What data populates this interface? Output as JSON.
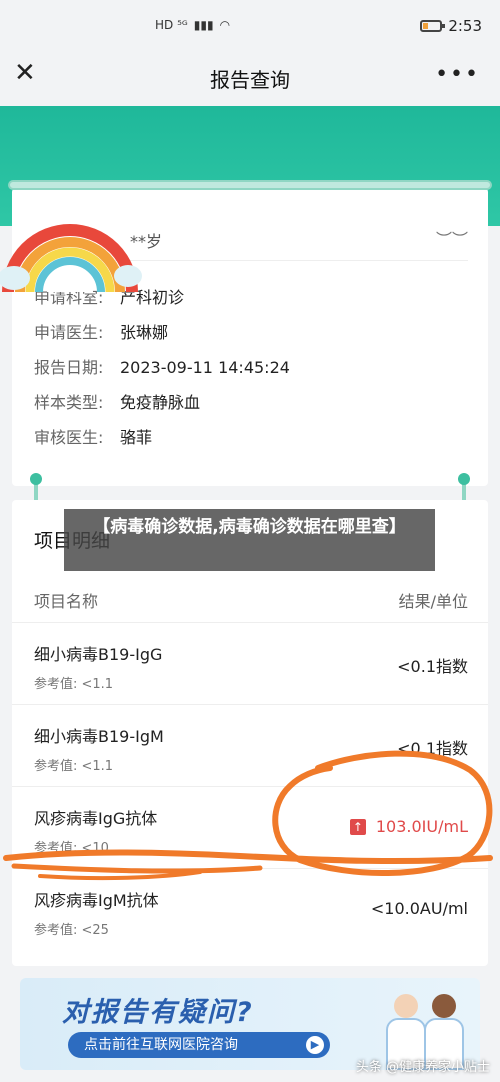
{
  "status_bar": {
    "network": "HD ⁵ᴳ",
    "time": "2:53"
  },
  "nav": {
    "title": "报告查询",
    "more": "•••",
    "close": "✕"
  },
  "patient": {
    "age_masked": "**岁",
    "rows": [
      {
        "label": "申请科室:",
        "value": "产科初诊"
      },
      {
        "label": "申请医生:",
        "value": "张琳娜"
      },
      {
        "label": "报告日期:",
        "value": "2023-09-11 14:45:24"
      },
      {
        "label": "样本类型:",
        "value": "免疫静脉血"
      },
      {
        "label": "审核医生:",
        "value": "骆菲"
      }
    ]
  },
  "details": {
    "title": "项目明细",
    "col_name": "项目名称",
    "col_result": "结果/单位",
    "items": [
      {
        "name": "细小病毒B19-IgG",
        "ref": "参考值: <1.1",
        "result": "<0.1指数",
        "high": false
      },
      {
        "name": "细小病毒B19-IgM",
        "ref": "参考值: <1.1",
        "result": "<0.1指数",
        "high": false
      },
      {
        "name": "风疹病毒IgG抗体",
        "ref": "参考值: <10",
        "result": "103.0IU/mL",
        "high": true
      },
      {
        "name": "风疹病毒IgM抗体",
        "ref": "参考值: <25",
        "result": "<10.0AU/ml",
        "high": false
      }
    ]
  },
  "overlay_title": "【病毒确诊数据,病毒确诊数据在哪里查】",
  "ad": {
    "headline": "对报告有疑问?",
    "cta": "点击前往互联网医院咨询",
    "cta_arrow": "▶"
  },
  "watermark": "头条 @健康养家小贴士",
  "colors": {
    "teal": "#2fc7a6",
    "high": "#e04a4a",
    "scribble": "#f07a2a"
  }
}
